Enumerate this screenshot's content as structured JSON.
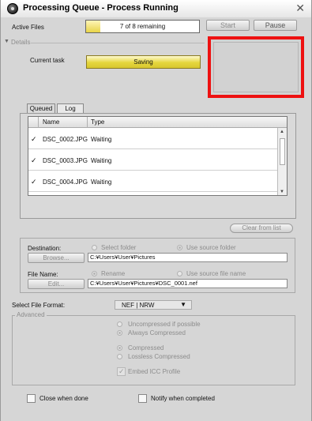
{
  "window": {
    "title": "Processing Queue - Process Running",
    "close_glyph": "✕",
    "app_icon": "lens-icon"
  },
  "active_files": {
    "label": "Active Files",
    "progress_text": "7 of 8 remaining",
    "progress_fraction": 0.125
  },
  "toolbar": {
    "start_label": "Start",
    "pause_label": "Pause"
  },
  "details": {
    "toggle_glyph": "▼",
    "label": "Details",
    "current_task_label": "Current task",
    "current_task_value": "Saving"
  },
  "tabs": [
    {
      "label": "Queued",
      "active": true
    },
    {
      "label": "Log",
      "active": false
    }
  ],
  "queue": {
    "columns": [
      "Name",
      "Type"
    ],
    "rows": [
      {
        "checked": true,
        "name": "DSC_0002.JPG",
        "type": "Waiting"
      },
      {
        "checked": true,
        "name": "DSC_0003.JPG",
        "type": "Waiting"
      },
      {
        "checked": true,
        "name": "DSC_0004.JPG",
        "type": "Waiting"
      }
    ],
    "clear_label": "Clear from list"
  },
  "destination": {
    "label": "Destination:",
    "option_select_folder": "Select folder",
    "option_use_source": "Use source folder",
    "browse_label": "Browse...",
    "path": "C:¥Users¥User¥Pictures"
  },
  "file_name": {
    "label": "File Name:",
    "option_rename": "Rename",
    "option_use_source": "Use source file name",
    "edit_label": "Edit...",
    "path": "C:¥Users¥User¥Pictures¥DSC_0001.nef"
  },
  "format": {
    "label": "Select File Format:",
    "selected": "NEF | NRW",
    "caret_glyph": "▼"
  },
  "advanced": {
    "label": "Advanced",
    "uncompressed": "Uncompressed if possible",
    "always_compressed": "Always Compressed",
    "compressed": "Compressed",
    "lossless": "Lossless Compressed",
    "embed_icc": "Embed ICC Profile"
  },
  "footer": {
    "close_when_done": "Close when done",
    "notify_when_completed": "Notify when completed"
  },
  "colors": {
    "highlight_border": "#ee1111",
    "task_bar": "#e5d63d"
  }
}
